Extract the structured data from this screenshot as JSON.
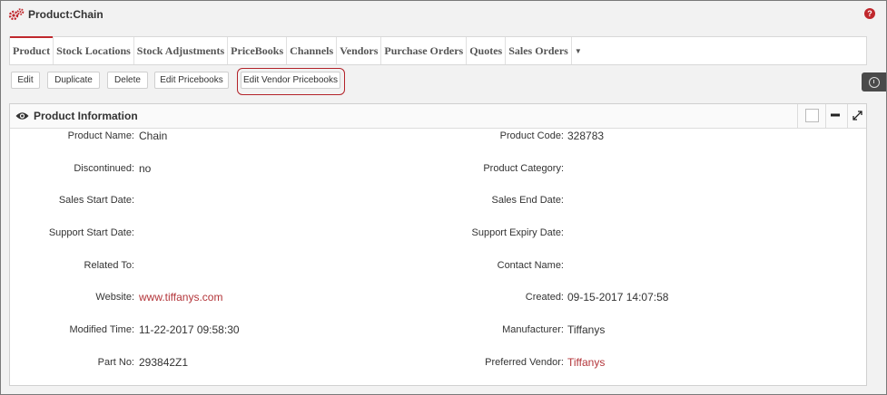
{
  "window": {
    "title": "Product:Chain",
    "help": "?"
  },
  "tabs": [
    {
      "label": "Product"
    },
    {
      "label": "Stock Locations"
    },
    {
      "label": "Stock Adjustments"
    },
    {
      "label": "PriceBooks"
    },
    {
      "label": "Channels"
    },
    {
      "label": "Vendors"
    },
    {
      "label": "Purchase Orders"
    },
    {
      "label": "Quotes"
    },
    {
      "label": "Sales Orders"
    }
  ],
  "tabs_more_icon": "caret-down-icon",
  "actions": {
    "edit": "Edit",
    "duplicate": "Duplicate",
    "delete": "Delete",
    "edit_pricebooks": "Edit Pricebooks",
    "edit_vendor_pricebooks": "Edit Vendor Pricebooks"
  },
  "panel": {
    "title": "Product Information",
    "left": [
      {
        "label": "Product Name:",
        "value": "Chain"
      },
      {
        "label": "Discontinued:",
        "value": "no"
      },
      {
        "label": "Sales Start Date:",
        "value": ""
      },
      {
        "label": "Support Start Date:",
        "value": ""
      },
      {
        "label": "Related To:",
        "value": ""
      },
      {
        "label": "Website:",
        "value": "www.tiffanys.com"
      },
      {
        "label": "Modified Time:",
        "value": "11-22-2017 09:58:30"
      },
      {
        "label": "Part No:",
        "value": "293842Z1"
      }
    ],
    "right": [
      {
        "label": "Product Code:",
        "value": "328783"
      },
      {
        "label": "Product Category:",
        "value": ""
      },
      {
        "label": "Sales End Date:",
        "value": ""
      },
      {
        "label": "Support Expiry Date:",
        "value": ""
      },
      {
        "label": "Contact Name:",
        "value": ""
      },
      {
        "label": "Created:",
        "value": "09-15-2017 14:07:58"
      },
      {
        "label": "Manufacturer:",
        "value": "Tiffanys"
      },
      {
        "label": "Preferred Vendor:",
        "value": "Tiffanys"
      }
    ]
  },
  "colors": {
    "accent": "#c0282d",
    "link": "#b3353a"
  }
}
